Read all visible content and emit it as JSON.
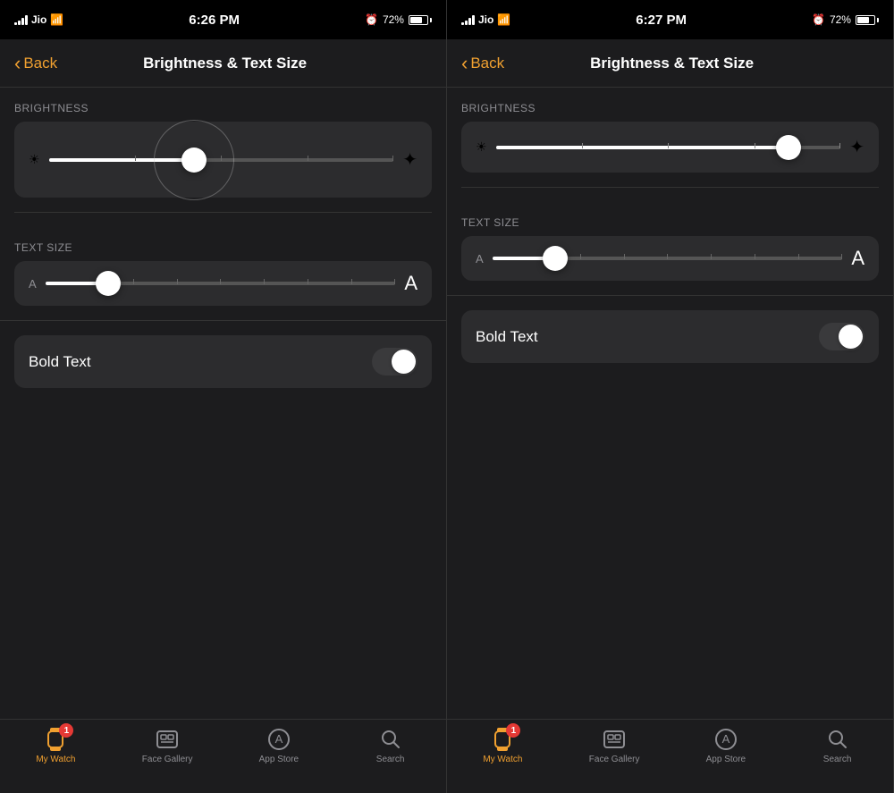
{
  "panels": [
    {
      "id": "panel-left",
      "status": {
        "carrier": "Jio",
        "time": "6:26 PM",
        "alarm": "⏰",
        "battery_pct": "72%"
      },
      "nav": {
        "back_label": "Back",
        "title": "Brightness & Text Size"
      },
      "brightness": {
        "label": "BRIGHTNESS",
        "value_pct": 42,
        "highlighted": true
      },
      "text_size": {
        "label": "TEXT SIZE",
        "value_pct": 18
      },
      "bold_text": {
        "label": "Bold Text",
        "enabled": false
      },
      "tabs": [
        {
          "id": "my-watch",
          "label": "My Watch",
          "active": true,
          "badge": "1"
        },
        {
          "id": "face-gallery",
          "label": "Face Gallery",
          "active": false
        },
        {
          "id": "app-store",
          "label": "App Store",
          "active": false
        },
        {
          "id": "search",
          "label": "Search",
          "active": false
        }
      ]
    },
    {
      "id": "panel-right",
      "status": {
        "carrier": "Jio",
        "time": "6:27 PM",
        "alarm": "⏰",
        "battery_pct": "72%"
      },
      "nav": {
        "back_label": "Back",
        "title": "Brightness & Text Size"
      },
      "brightness": {
        "label": "BRIGHTNESS",
        "value_pct": 85,
        "highlighted": false
      },
      "text_size": {
        "label": "TEXT SIZE",
        "value_pct": 18
      },
      "bold_text": {
        "label": "Bold Text",
        "enabled": false
      },
      "tabs": [
        {
          "id": "my-watch",
          "label": "My Watch",
          "active": true,
          "badge": "1"
        },
        {
          "id": "face-gallery",
          "label": "Face Gallery",
          "active": false
        },
        {
          "id": "app-store",
          "label": "App Store",
          "active": false
        },
        {
          "id": "search",
          "label": "Search",
          "active": false
        }
      ]
    }
  ]
}
